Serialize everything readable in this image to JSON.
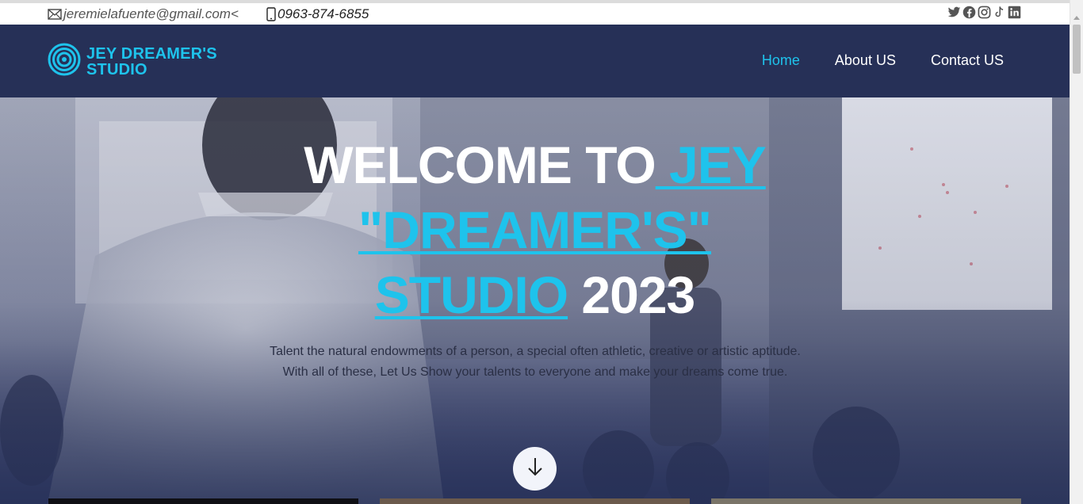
{
  "topbar": {
    "email": "jeremielafuente@gmail.com<",
    "phone": "0963-874-6855",
    "socials": [
      "twitter-icon",
      "facebook-icon",
      "instagram-icon",
      "tiktok-icon",
      "linkedin-icon"
    ]
  },
  "brand": {
    "line1": "JEY DREAMER'S",
    "line2": "STUDIO",
    "accent_color": "#1ec3ec",
    "nav_bg": "#263057"
  },
  "nav": {
    "items": [
      {
        "label": "Home",
        "active": true
      },
      {
        "label": "About US",
        "active": false
      },
      {
        "label": "Contact US",
        "active": false
      }
    ]
  },
  "hero": {
    "title_part1": "WELCOME TO",
    "title_accent1": " JEY",
    "title_accent2": "\"DREAMER'S\"",
    "title_accent3": "STUDIO",
    "title_part2": " 2023",
    "description": "Talent the natural endowments of a person, a special often athletic, creative or artistic aptitude. With all of these, Let Us Show your talents to everyone and make your dreams come true.",
    "scroll_icon": "arrow-down-icon"
  }
}
